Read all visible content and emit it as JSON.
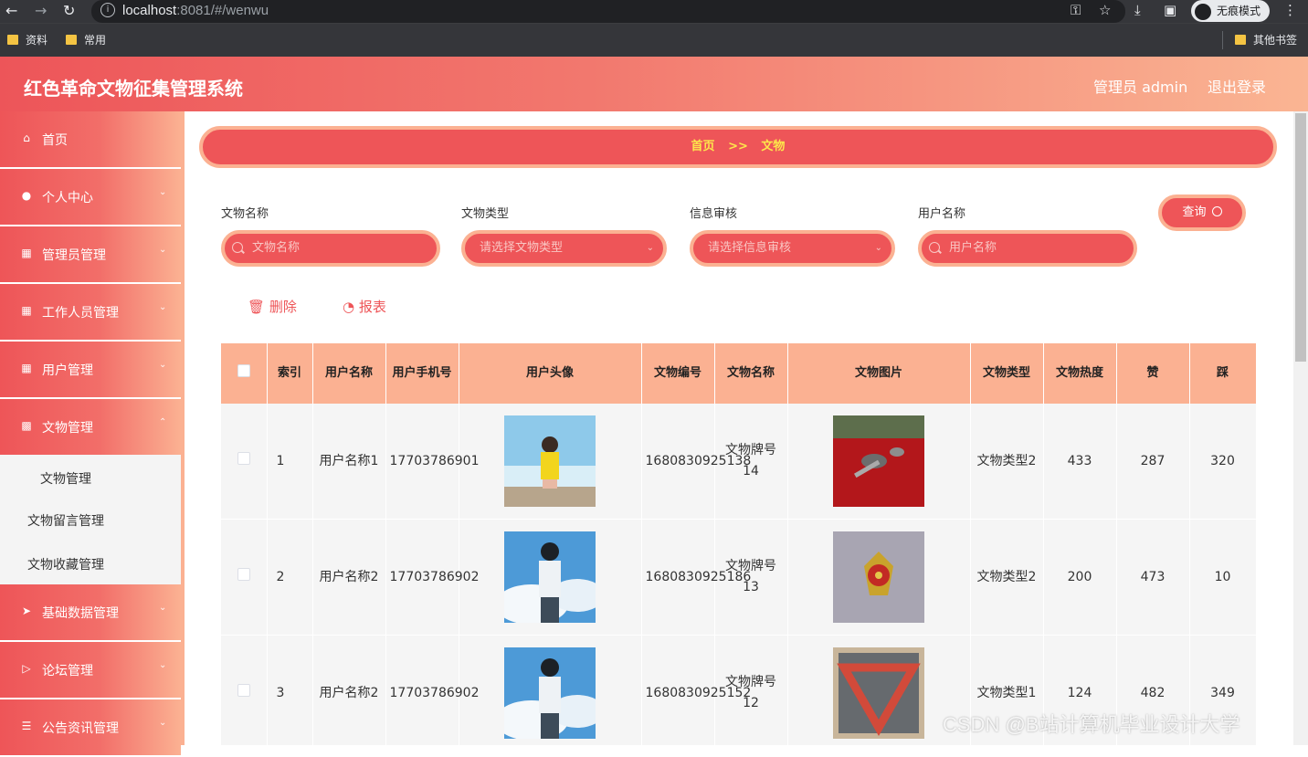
{
  "browser": {
    "url_host": "localhost",
    "url_rest": ":8081/#/wenwu",
    "incognito_label": "无痕模式",
    "bookmarks": [
      "资料",
      "常用"
    ],
    "other_bookmarks": "其他书签"
  },
  "header": {
    "title": "红色革命文物征集管理系统",
    "admin_label": "管理员 admin",
    "logout_label": "退出登录"
  },
  "sidebar": {
    "items": [
      {
        "label": "首页",
        "icon": "home-icon"
      },
      {
        "label": "个人中心",
        "icon": "user-icon"
      },
      {
        "label": "管理员管理",
        "icon": "grid-icon"
      },
      {
        "label": "工作人员管理",
        "icon": "grid-icon"
      },
      {
        "label": "用户管理",
        "icon": "grid-icon"
      },
      {
        "label": "文物管理",
        "icon": "clipboard-icon"
      },
      {
        "label": "基础数据管理",
        "icon": "send-icon"
      },
      {
        "label": "论坛管理",
        "icon": "video-icon"
      },
      {
        "label": "公告资讯管理",
        "icon": "list-icon"
      }
    ],
    "submenu": [
      "文物管理",
      "文物留言管理",
      "文物收藏管理"
    ]
  },
  "breadcrumb": {
    "home": "首页",
    "separator": ">>",
    "current": "文物"
  },
  "filters": {
    "name_label": "文物名称",
    "name_placeholder": "文物名称",
    "type_label": "文物类型",
    "type_placeholder": "请选择文物类型",
    "audit_label": "信息审核",
    "audit_placeholder": "请选择信息审核",
    "user_label": "用户名称",
    "user_placeholder": "用户名称",
    "query_label": "查询"
  },
  "actions": {
    "delete_label": "删除",
    "report_label": "报表"
  },
  "table": {
    "headers": [
      "索引",
      "用户名称",
      "用户手机号",
      "用户头像",
      "文物编号",
      "文物名称",
      "文物图片",
      "文物类型",
      "文物热度",
      "赞",
      "踩"
    ],
    "rows": [
      {
        "index": "1",
        "user_name": "用户名称1",
        "phone": "17703786901",
        "serial": "1680830925138",
        "name": "文物牌号14",
        "type": "文物类型2",
        "heat": "433",
        "like": "287",
        "dislike": "320"
      },
      {
        "index": "2",
        "user_name": "用户名称2",
        "phone": "17703786902",
        "serial": "1680830925186",
        "name": "文物牌号13",
        "type": "文物类型2",
        "heat": "200",
        "like": "473",
        "dislike": "10"
      },
      {
        "index": "3",
        "user_name": "用户名称2",
        "phone": "17703786902",
        "serial": "1680830925152",
        "name": "文物牌号12",
        "type": "文物类型1",
        "heat": "124",
        "like": "482",
        "dislike": "349"
      }
    ]
  },
  "watermark": "CSDN @B站计算机毕业设计大学",
  "colors": {
    "primary": "#ee5558",
    "accent": "#fbb192",
    "breadcrumb_text": "#fde64b"
  }
}
